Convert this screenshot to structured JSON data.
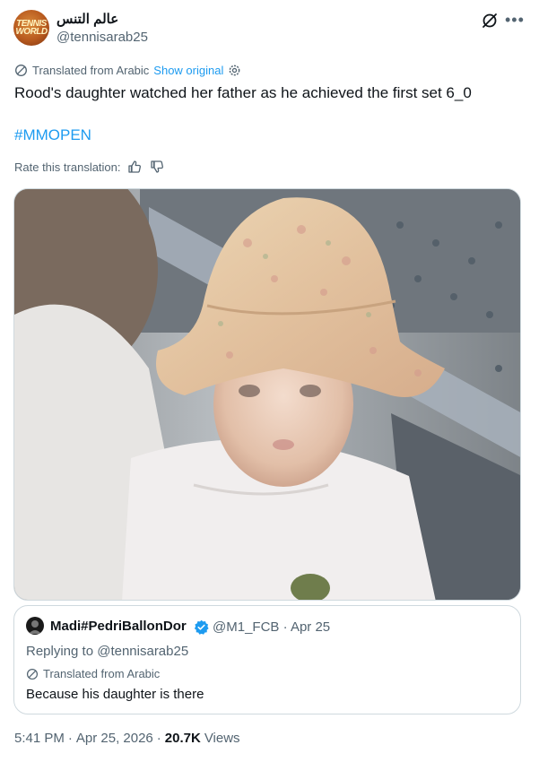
{
  "post": {
    "display_name": "عالم التنس",
    "handle": "@tennisarab25",
    "avatar_text": "TENNIS WORLD",
    "translated_label": "Translated from Arabic",
    "show_original": "Show original",
    "text": "Rood's daughter watched her father as he achieved the first set 6_0",
    "hashtag": "#MMOPEN",
    "rate_label": "Rate this translation:",
    "icons": [
      "grok-icon",
      "more-icon",
      "globe-icon",
      "gear-icon",
      "thumbs-up-icon",
      "thumbs-down-icon"
    ]
  },
  "quote": {
    "name": "Madi#PedriBallonDor",
    "handle": "@M1_FCB",
    "dot": "·",
    "date": "Apr 25",
    "replying_prefix": "Replying to",
    "replying_to": "@tennisarab25",
    "translated_label": "Translated from Arabic",
    "text": "Because his daughter is there"
  },
  "footer": {
    "time": "5:41 PM",
    "dot1": "·",
    "date": "Apr 25, 2026",
    "dot2": "·",
    "views_count": "20.7K",
    "views_label": "Views"
  },
  "colors": {
    "accent": "#1d9bf0",
    "secondary_text": "#536471",
    "primary_text": "#0f1419",
    "border": "#cfd9de"
  }
}
